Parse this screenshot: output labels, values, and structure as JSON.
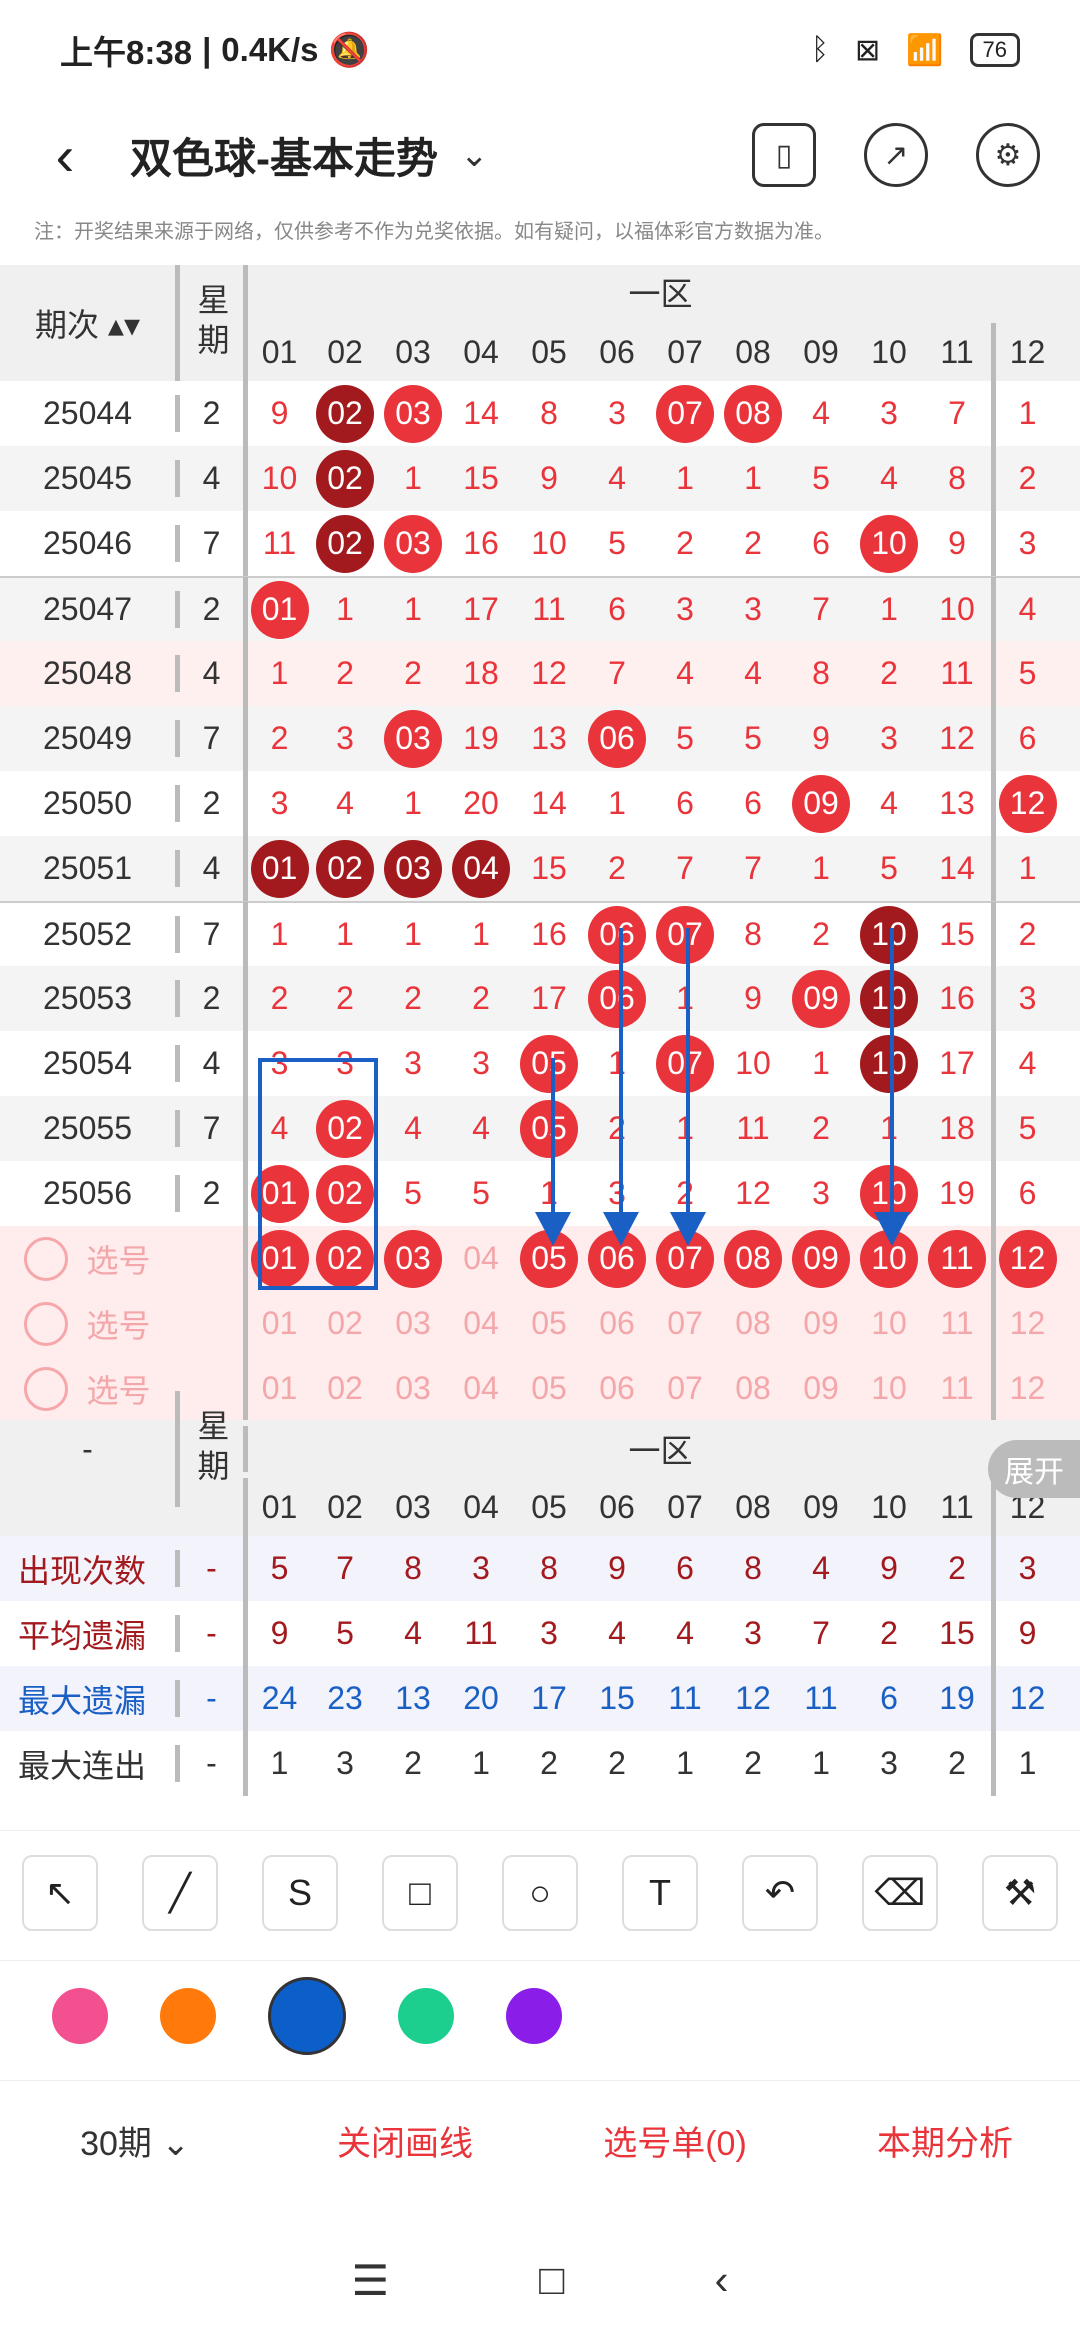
{
  "status": {
    "time": "上午8:38",
    "speed": "0.4K/s",
    "battery": "76"
  },
  "title": {
    "text": "双色球-基本走势",
    "chevron": "⌄",
    "icons": [
      "phone-rotate-icon",
      "share-icon",
      "settings-icon"
    ]
  },
  "note": "注：开奖结果来源于网络，仅供参考不作为兑奖依据。如有疑问，以福体彩官方数据为准。",
  "table": {
    "issue_header": "期次",
    "week_header": "星期",
    "zone_label": "一区",
    "cols": [
      "01",
      "02",
      "03",
      "04",
      "05",
      "06",
      "07",
      "08",
      "09",
      "10",
      "11",
      "12"
    ],
    "rows": [
      {
        "issue": "25044",
        "week": "2",
        "cells": [
          "9",
          "02",
          "03",
          "14",
          "8",
          "3",
          "07",
          "08",
          "4",
          "3",
          "7",
          "1"
        ],
        "marks": [
          0,
          2,
          1,
          0,
          0,
          0,
          1,
          1,
          0,
          0,
          0,
          0
        ]
      },
      {
        "issue": "25045",
        "week": "4",
        "cells": [
          "10",
          "02",
          "1",
          "15",
          "9",
          "4",
          "1",
          "1",
          "5",
          "4",
          "8",
          "2"
        ],
        "marks": [
          0,
          2,
          0,
          0,
          0,
          0,
          0,
          0,
          0,
          0,
          0,
          0
        ]
      },
      {
        "issue": "25046",
        "week": "7",
        "cells": [
          "11",
          "02",
          "03",
          "16",
          "10",
          "5",
          "2",
          "2",
          "6",
          "10",
          "9",
          "3"
        ],
        "marks": [
          0,
          2,
          1,
          0,
          0,
          0,
          0,
          0,
          0,
          1,
          0,
          0
        ]
      },
      {
        "issue": "25047",
        "week": "2",
        "cells": [
          "01",
          "1",
          "1",
          "17",
          "11",
          "6",
          "3",
          "3",
          "7",
          "1",
          "10",
          "4"
        ],
        "marks": [
          1,
          0,
          0,
          0,
          0,
          0,
          0,
          0,
          0,
          0,
          0,
          0
        ]
      },
      {
        "issue": "25048",
        "week": "4",
        "cells": [
          "1",
          "2",
          "2",
          "18",
          "12",
          "7",
          "4",
          "4",
          "8",
          "2",
          "11",
          "5"
        ],
        "marks": [
          0,
          0,
          0,
          0,
          0,
          0,
          0,
          0,
          0,
          0,
          0,
          0
        ]
      },
      {
        "issue": "25049",
        "week": "7",
        "cells": [
          "2",
          "3",
          "03",
          "19",
          "13",
          "06",
          "5",
          "5",
          "9",
          "3",
          "12",
          "6"
        ],
        "marks": [
          0,
          0,
          1,
          0,
          0,
          1,
          0,
          0,
          0,
          0,
          0,
          0
        ]
      },
      {
        "issue": "25050",
        "week": "2",
        "cells": [
          "3",
          "4",
          "1",
          "20",
          "14",
          "1",
          "6",
          "6",
          "09",
          "4",
          "13",
          "12"
        ],
        "marks": [
          0,
          0,
          0,
          0,
          0,
          0,
          0,
          0,
          1,
          0,
          0,
          1
        ]
      },
      {
        "issue": "25051",
        "week": "4",
        "cells": [
          "01",
          "02",
          "03",
          "04",
          "15",
          "2",
          "7",
          "7",
          "1",
          "5",
          "14",
          "1"
        ],
        "marks": [
          2,
          2,
          2,
          2,
          0,
          0,
          0,
          0,
          0,
          0,
          0,
          0
        ]
      },
      {
        "issue": "25052",
        "week": "7",
        "cells": [
          "1",
          "1",
          "1",
          "1",
          "16",
          "06",
          "07",
          "8",
          "2",
          "10",
          "15",
          "2"
        ],
        "marks": [
          0,
          0,
          0,
          0,
          0,
          1,
          1,
          0,
          0,
          2,
          0,
          0
        ]
      },
      {
        "issue": "25053",
        "week": "2",
        "cells": [
          "2",
          "2",
          "2",
          "2",
          "17",
          "06",
          "1",
          "9",
          "09",
          "10",
          "16",
          "3"
        ],
        "marks": [
          0,
          0,
          0,
          0,
          0,
          1,
          0,
          0,
          1,
          2,
          0,
          0
        ]
      },
      {
        "issue": "25054",
        "week": "4",
        "cells": [
          "3",
          "3",
          "3",
          "3",
          "05",
          "1",
          "07",
          "10",
          "1",
          "10",
          "17",
          "4"
        ],
        "marks": [
          0,
          0,
          0,
          0,
          1,
          0,
          1,
          0,
          0,
          2,
          0,
          0
        ]
      },
      {
        "issue": "25055",
        "week": "7",
        "cells": [
          "4",
          "02",
          "4",
          "4",
          "05",
          "2",
          "1",
          "11",
          "2",
          "1",
          "18",
          "5"
        ],
        "marks": [
          0,
          1,
          0,
          0,
          1,
          0,
          0,
          0,
          0,
          0,
          0,
          0
        ]
      },
      {
        "issue": "25056",
        "week": "2",
        "cells": [
          "01",
          "02",
          "5",
          "5",
          "1",
          "3",
          "2",
          "12",
          "3",
          "10",
          "19",
          "6"
        ],
        "marks": [
          1,
          1,
          0,
          0,
          0,
          0,
          0,
          0,
          0,
          1,
          0,
          0
        ]
      }
    ],
    "pick_label": "选号",
    "pick_first": [
      "01",
      "02",
      "03",
      "04",
      "05",
      "06",
      "07",
      "08",
      "09",
      "10",
      "11",
      "12"
    ],
    "pick_first_marks": [
      1,
      1,
      1,
      0,
      1,
      1,
      1,
      1,
      1,
      1,
      1,
      1
    ],
    "pick_rows": [
      [
        "01",
        "02",
        "03",
        "04",
        "05",
        "06",
        "07",
        "08",
        "09",
        "10",
        "11",
        "12"
      ],
      [
        "01",
        "02",
        "03",
        "04",
        "05",
        "06",
        "07",
        "08",
        "09",
        "10",
        "11",
        "12"
      ]
    ]
  },
  "stats": {
    "dash": "-",
    "expand": "展开",
    "rows": [
      {
        "label": "出现次数",
        "color": "#a31a1e",
        "vals": [
          "5",
          "7",
          "8",
          "3",
          "8",
          "9",
          "6",
          "8",
          "4",
          "9",
          "2",
          "3"
        ]
      },
      {
        "label": "平均遗漏",
        "color": "#a31a1e",
        "vals": [
          "9",
          "5",
          "4",
          "11",
          "3",
          "4",
          "4",
          "3",
          "7",
          "2",
          "15",
          "9"
        ]
      },
      {
        "label": "最大遗漏",
        "color": "#1a5fc4",
        "vals": [
          "24",
          "23",
          "13",
          "20",
          "17",
          "15",
          "11",
          "12",
          "11",
          "6",
          "19",
          "12"
        ]
      },
      {
        "label": "最大连出",
        "color": "#333333",
        "vals": [
          "1",
          "3",
          "2",
          "1",
          "2",
          "2",
          "1",
          "2",
          "1",
          "3",
          "2",
          "1"
        ]
      }
    ]
  },
  "tools": [
    "↖",
    "╱",
    "S",
    "□",
    "○",
    "T",
    "↶",
    "⌫",
    "⚒"
  ],
  "tool_names": [
    "select-arrow-icon",
    "line-icon",
    "curve-icon",
    "rectangle-icon",
    "circle-icon",
    "text-icon",
    "undo-icon",
    "eraser-icon",
    "clear-icon"
  ],
  "swatches": [
    "#f2508f",
    "#ff7a0a",
    "#0c5ec9",
    "#1ccf8f",
    "#8a1de8"
  ],
  "bottom": {
    "periods": "30期",
    "close_draw": "关闭画线",
    "pick_list": "选号单(0)",
    "analysis": "本期分析"
  },
  "nav": [
    "☰",
    "□",
    "‹"
  ]
}
